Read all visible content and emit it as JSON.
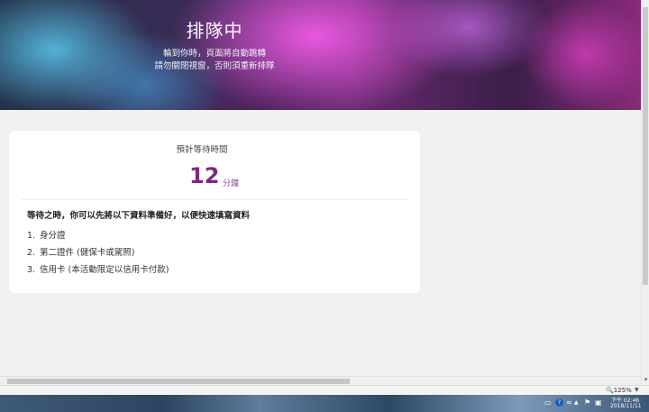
{
  "hero": {
    "title": "排隊中",
    "line1": "輪到你時，頁面將自動跳轉",
    "line2": "請勿關閉視窗，否則須重新排隊"
  },
  "card": {
    "wait_label": "預計等待時間",
    "wait_number": "12",
    "wait_unit": "分鐘",
    "notice": "等待之時，你可以先將以下資料準備好，以便快速填寫資料",
    "items": [
      {
        "num": "1.",
        "text": "身分證"
      },
      {
        "num": "2.",
        "text": "第二證件 (健保卡或駕照)"
      },
      {
        "num": "3.",
        "text": "信用卡 (本活動限定以信用卡付款)"
      }
    ]
  },
  "statusbar": {
    "zoom": "125%"
  },
  "taskbar": {
    "time": "下午 02:46",
    "date": "2018/11/11",
    "icons": [
      "ime-icon",
      "help-icon",
      "wifi-icon",
      "show-hidden-icons-icon",
      "flag-icon",
      "network-icon"
    ]
  },
  "colors": {
    "accent": "#7b2a7b",
    "card_bg": "#ffffff",
    "page_bg": "#f1f1f1"
  }
}
